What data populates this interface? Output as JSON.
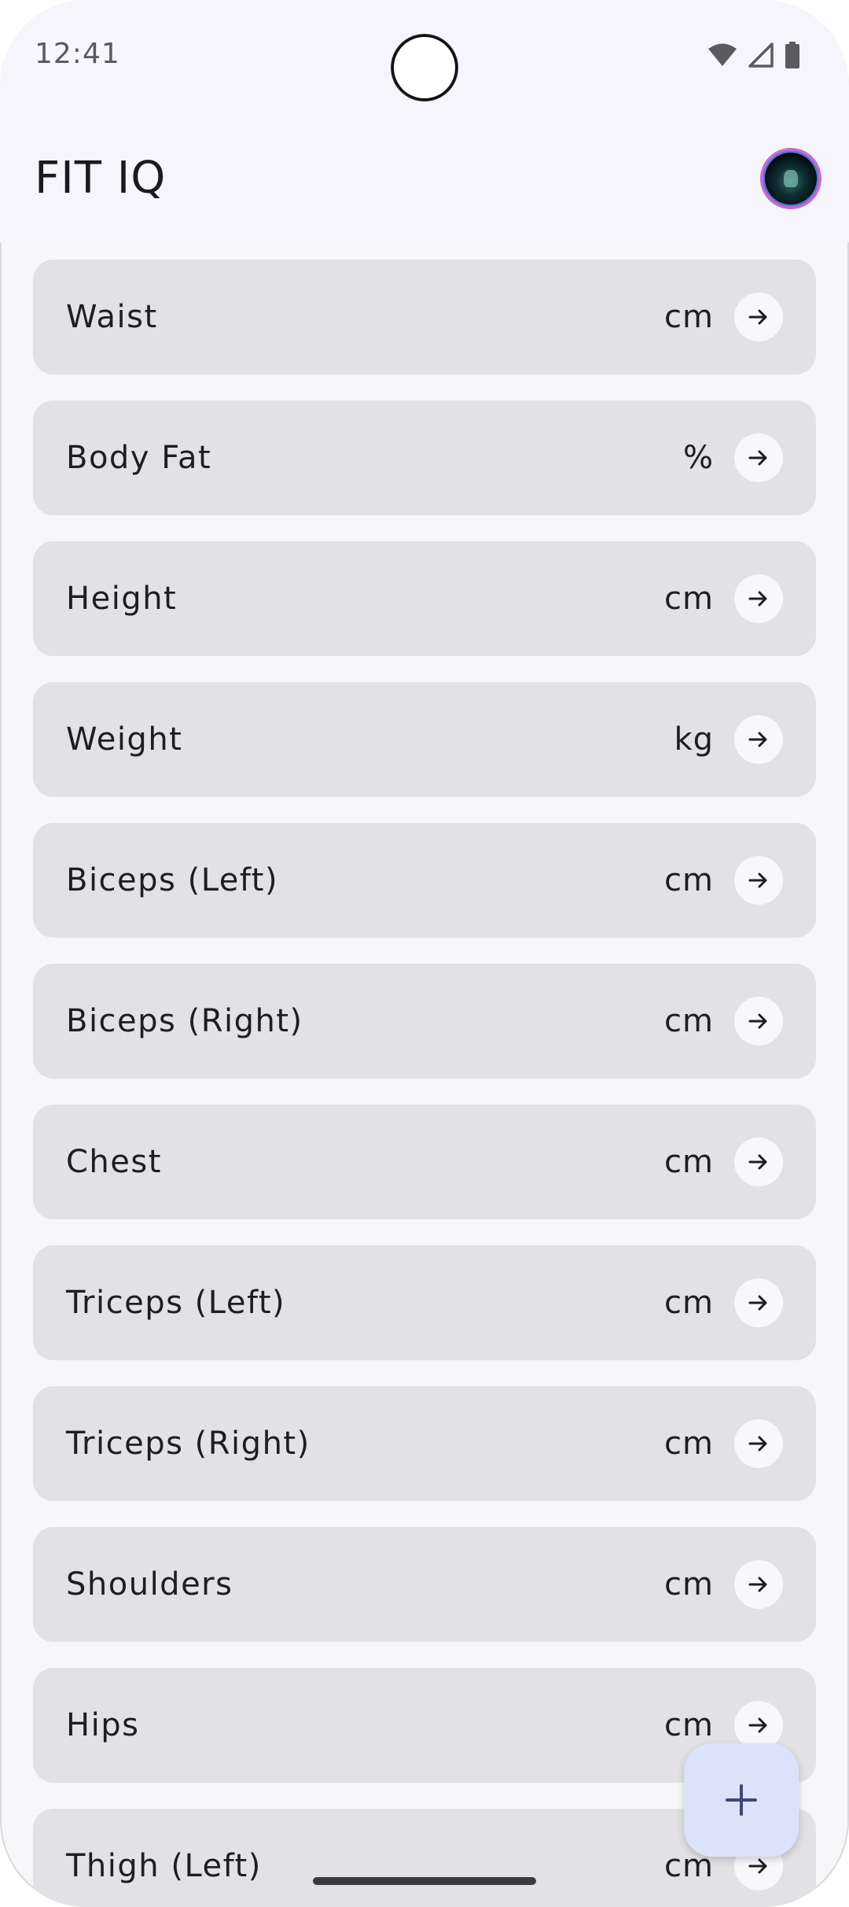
{
  "status_bar": {
    "time": "12:41",
    "icons": [
      "wifi-icon",
      "cell-signal-icon",
      "battery-icon"
    ]
  },
  "app_bar": {
    "title": "FIT IQ",
    "avatar": "profile-avatar"
  },
  "measurements": [
    {
      "label": "Waist",
      "unit": "cm"
    },
    {
      "label": "Body Fat",
      "unit": "%"
    },
    {
      "label": "Height",
      "unit": "cm"
    },
    {
      "label": "Weight",
      "unit": "kg"
    },
    {
      "label": "Biceps (Left)",
      "unit": "cm"
    },
    {
      "label": "Biceps (Right)",
      "unit": "cm"
    },
    {
      "label": "Chest",
      "unit": "cm"
    },
    {
      "label": "Triceps (Left)",
      "unit": "cm"
    },
    {
      "label": "Triceps (Right)",
      "unit": "cm"
    },
    {
      "label": "Shoulders",
      "unit": "cm"
    },
    {
      "label": "Hips",
      "unit": "cm"
    },
    {
      "label": "Thigh (Left)",
      "unit": "cm"
    }
  ],
  "fab": {
    "icon": "plus-icon"
  },
  "colors": {
    "card_background": "#e1e1e6",
    "fab_background": "#dce2f9",
    "fab_icon": "#3c4a74"
  }
}
